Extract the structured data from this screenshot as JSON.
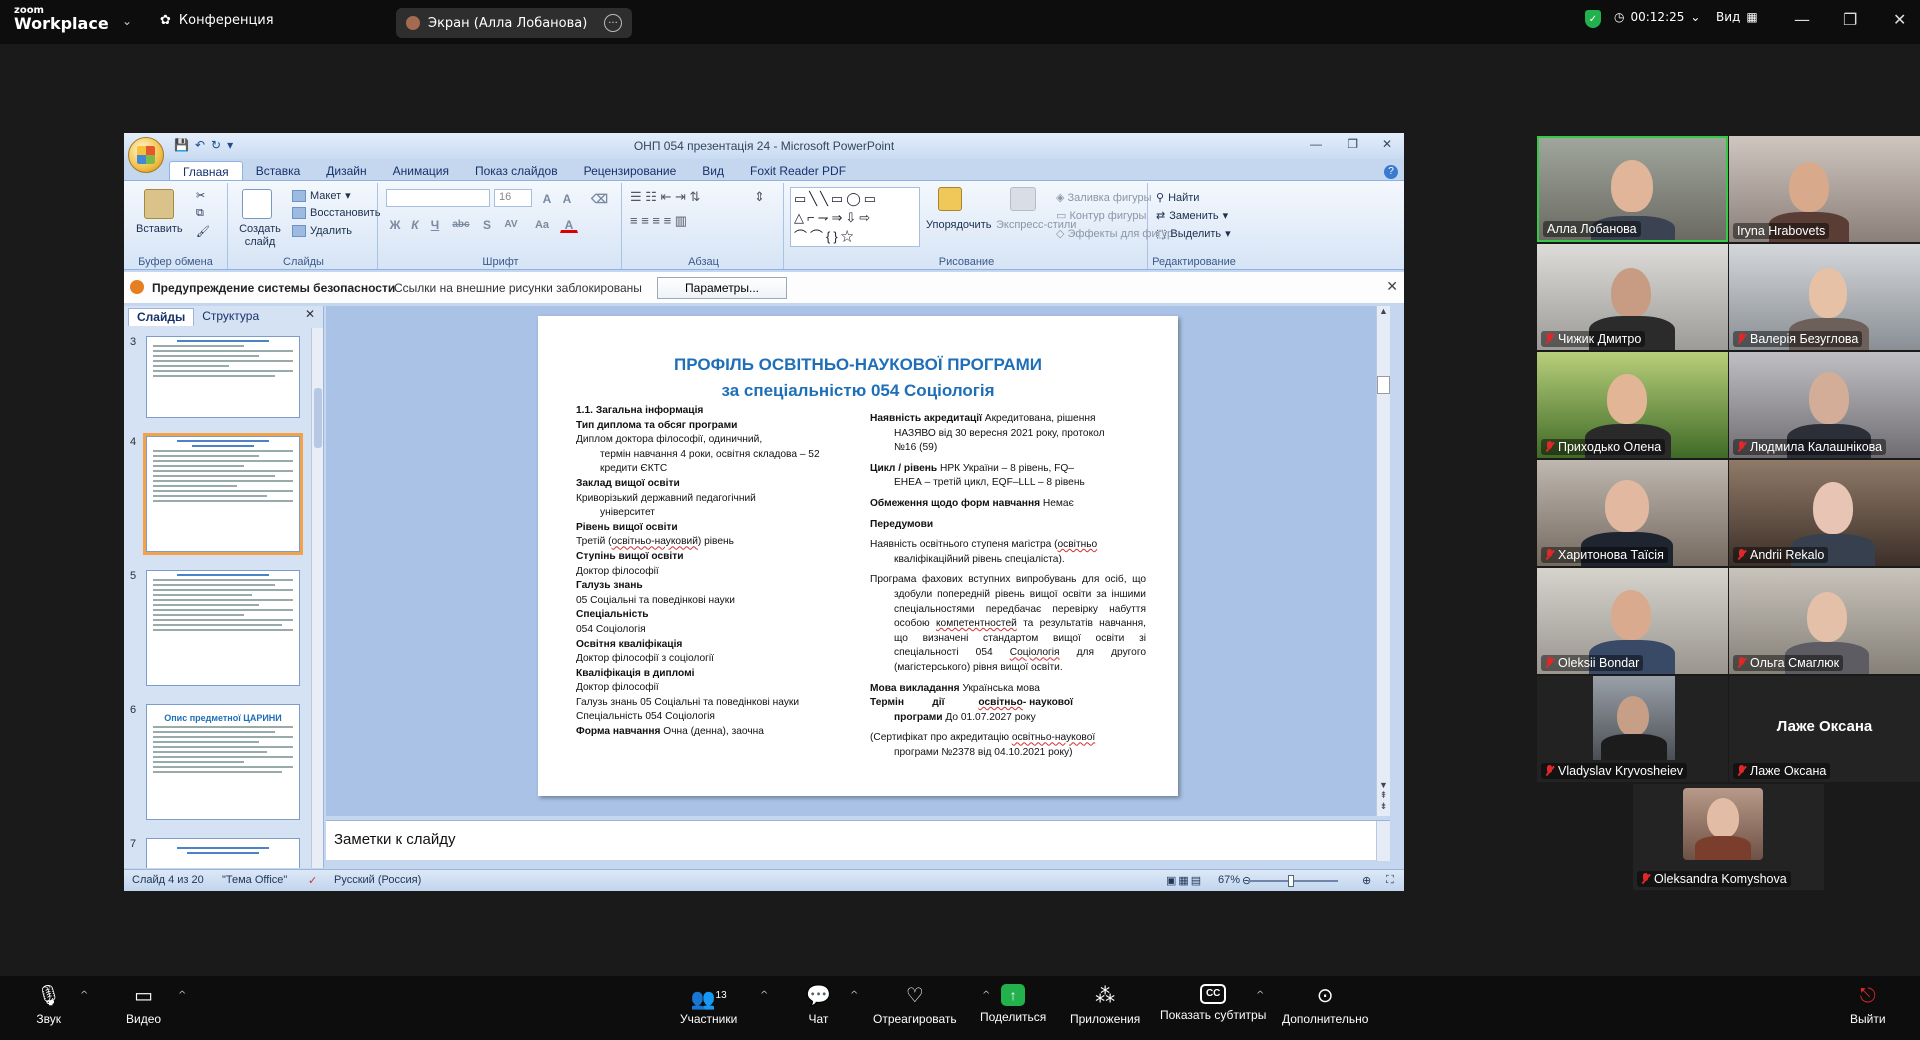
{
  "zoom": {
    "logo_top": "zoom",
    "logo_bottom": "Workplace",
    "meeting_label": "Конференция",
    "screen_share_label": "Экран (Алла Лобанова)",
    "timer": "00:12:25",
    "view_label": "Вид",
    "accent_green": "#22b14c"
  },
  "ppt": {
    "window_title": "ОНП 054 презентація 24 - Microsoft PowerPoint",
    "tabs": [
      "Главная",
      "Вставка",
      "Дизайн",
      "Анимация",
      "Показ слайдов",
      "Рецензирование",
      "Вид",
      "Foxit Reader PDF"
    ],
    "ribbon": {
      "clipboard": {
        "paste": "Вставить",
        "group": "Буфер обмена"
      },
      "slides": {
        "new_slide": "Создать слайд",
        "layout": "Макет",
        "reset": "Восстановить",
        "delete": "Удалить",
        "group": "Слайды"
      },
      "font": {
        "size": "16",
        "group": "Шрифт",
        "bold": "Ж",
        "italic": "К",
        "underline": "Ч",
        "strike": "abc",
        "shadow": "S",
        "spacing": "AV",
        "case": "Aa",
        "color": "A"
      },
      "paragraph": {
        "group": "Абзац"
      },
      "drawing": {
        "arrange": "Упорядочить",
        "quick_styles": "Экспресс-стили",
        "fill": "Заливка фигуры",
        "outline": "Контур фигуры",
        "effects": "Эффекты для фигур",
        "group": "Рисование"
      },
      "editing": {
        "find": "Найти",
        "replace": "Заменить",
        "select": "Выделить",
        "group": "Редактирование"
      }
    },
    "security": {
      "warning": "Предупреждение системы безопасности",
      "message": "Ссылки на внешние рисунки заблокированы",
      "options_button": "Параметры..."
    },
    "left_tabs": {
      "slides": "Слайды",
      "outline": "Структура"
    },
    "thumb_numbers": [
      "3",
      "4",
      "5",
      "6",
      "7"
    ],
    "thumb_titles": {
      "t6": "Опис предметної ЦАРИНИ"
    },
    "notes_placeholder": "Заметки к слайду",
    "status": {
      "slide_info": "Слайд 4 из 20",
      "theme": "\"Тема Office\"",
      "language": "Русский (Россия)",
      "zoom": "67%"
    }
  },
  "slide": {
    "title_line1": "ПРОФІЛЬ ОСВІТНЬО-НАУКОВОЇ ПРОГРАМИ",
    "title_line2": "за спеціальністю  054 Соціологія",
    "left": {
      "h1": "1.1. Загальна інформація",
      "h2": "Тип диплома  та обсяг  програми",
      "p2a": "Диплом      доктора      філософії,      одиничний,",
      "p2b": "термін навчання  4 роки, освітня складова – 52 кредити ЄКТС",
      "h3": "Заклад вищої освіти",
      "p3a": "Криворізький державний педагогічний",
      "p3b": "університет",
      "h4": "Рівень вищої освіти",
      "p4_pre": "Третій (",
      "p4_mid": "освітньо-науковий",
      "p4_post": ")  рівень",
      "h5": "Ступінь вищої освіти",
      "p5": "Доктор філософії",
      "h6": "Галузь знань",
      "p6": "05 Соціальні  та поведінкові  науки",
      "h7": "Спеціальність",
      "p7": "054 Соціологія",
      "h8": "Освітня кваліфікація",
      "p8": "Доктор філософії з соціології",
      "h9": "Кваліфікація в дипломі",
      "p9a": "Доктор філософії",
      "p9b": "Галузь знань  05 Соціальні та поведінкові науки",
      "p9c": "Спеціальність 054 Соціологія",
      "h10": "Форма навчання",
      "p10": " Очна (денна), заочна"
    },
    "right": {
      "h1": "Наявність акредитації",
      "p1a": " Акредитована, рішення",
      "p1b": "НАЗЯВО від 30 вересня  2021 року, протокол",
      "p1c": "№16 (59)",
      "h2": "Цикл / рівень",
      "p2a": " НРК України   – 8          рівень, FQ–",
      "p2b": "ЕНЕА – третій цикл, EQF–LLL – 8 рівень",
      "h3": "Обмеження щодо форм  навчання",
      "p3": " Немає",
      "h4": "Передумови",
      "p4a": "Наявність освітнього ступеня магістра  (",
      "p4a_u": "освітньо",
      "p4b": "кваліфікаційний рівень спеціаліста).",
      "p5": "Програма фахових вступних випробувань для осіб, що здобули попередній рівень вищої освіти за іншими спеціальностями передбачає перевірку набуття особою ",
      "p5_u": "компетентностей",
      "p5b": " та результатів навчання, що визначені стандартом вищої освіти зі спеціальності 054 ",
      "p5_u2": "Соціологія",
      "p5c": "  для другого (магістерського) рівня вищої освіти.",
      "h6": "Мова викладання",
      "p6": " Українська мова",
      "h7a": "Термін          дії            ",
      "h7a_u": "освітньо",
      "h7a_b": "- наукової",
      "h7b": "програми",
      "p7": " До 01.07.2027  року",
      "p8a": "(Сертифікат про акредитацію ",
      "p8a_u": "освітньо-наукової",
      "p8b": "програми №2378  від 04.10.2021  року)"
    }
  },
  "participants": [
    {
      "name": "Алла Лобанова",
      "muted": false,
      "active": true
    },
    {
      "name": "Iryna Hrabovets",
      "muted": false
    },
    {
      "name": "Чижик Дмитро",
      "muted": true
    },
    {
      "name": "Валерія Безуглова",
      "muted": true
    },
    {
      "name": "Приходько Олена",
      "muted": true
    },
    {
      "name": "Людмила Калашнікова",
      "muted": true
    },
    {
      "name": "Харитонова Таїсія",
      "muted": true
    },
    {
      "name": "Andrii Rekalo",
      "muted": true
    },
    {
      "name": "Oleksii Bondar",
      "muted": true
    },
    {
      "name": "Ольга Смаглюк",
      "muted": true
    },
    {
      "name": "Vladyslav Kryvosheiev",
      "muted": true
    },
    {
      "name": "Лаже Оксана",
      "muted": true,
      "no_video": true
    },
    {
      "name": "Oleksandra Komyshova",
      "muted": true
    }
  ],
  "toolbar": {
    "audio": "Звук",
    "video": "Видео",
    "participants": "Участники",
    "participants_count": "13",
    "chat": "Чат",
    "react": "Отреагировать",
    "share": "Поделиться",
    "apps": "Приложения",
    "captions": "Показать субтитры",
    "more": "Дополнительно",
    "leave": "Выйти"
  }
}
